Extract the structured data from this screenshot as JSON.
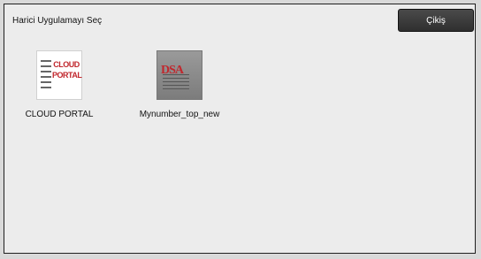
{
  "header": {
    "title": "Harici Uygulamayı Seç",
    "exit_label": "Çikiş"
  },
  "apps": [
    {
      "label": "CLOUD PORTAL",
      "icon_text_1": "CLOUD",
      "icon_text_2": "PORTAL",
      "icon": "cloud-portal-icon"
    },
    {
      "label": "Mynumber_top_new",
      "icon_text": "DSA",
      "icon": "mynumber-icon"
    }
  ],
  "colors": {
    "accent": "#c1272d",
    "button": "#333333",
    "background": "#ececec"
  }
}
